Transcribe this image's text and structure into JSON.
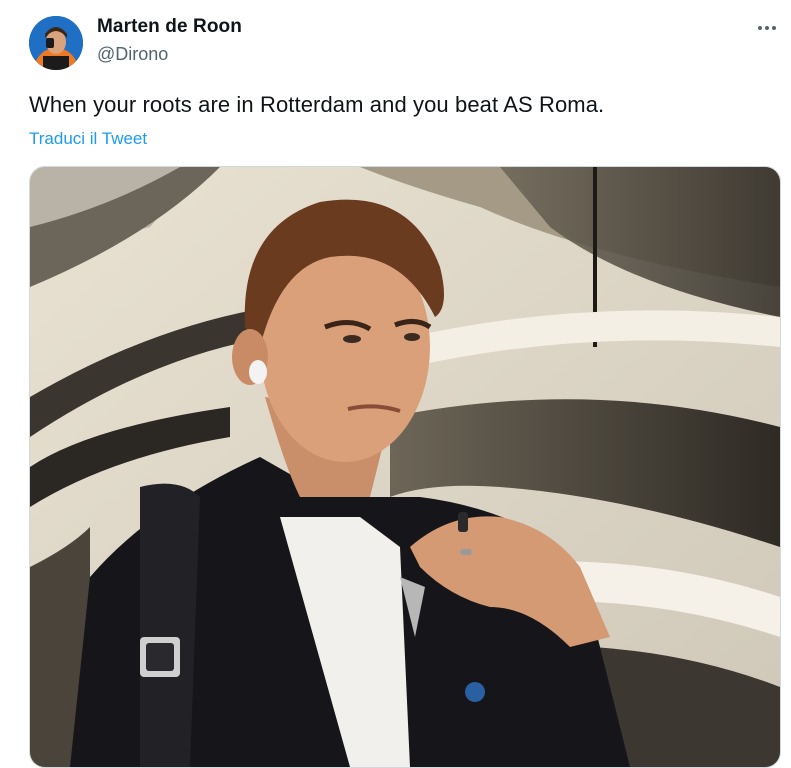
{
  "tweet": {
    "author_name": "Marten de Roon",
    "author_handle": "@Dirono",
    "text": "When your roots are in Rotterdam and you beat AS Roma.",
    "translate_label": "Traduci il Tweet",
    "more_icon": "more-horizontal-icon",
    "avatar_icon": "avatar",
    "media_icon": "photo"
  },
  "colors": {
    "link": "#1d9bf0",
    "secondary_text": "#536471",
    "primary_text": "#0f1419"
  }
}
